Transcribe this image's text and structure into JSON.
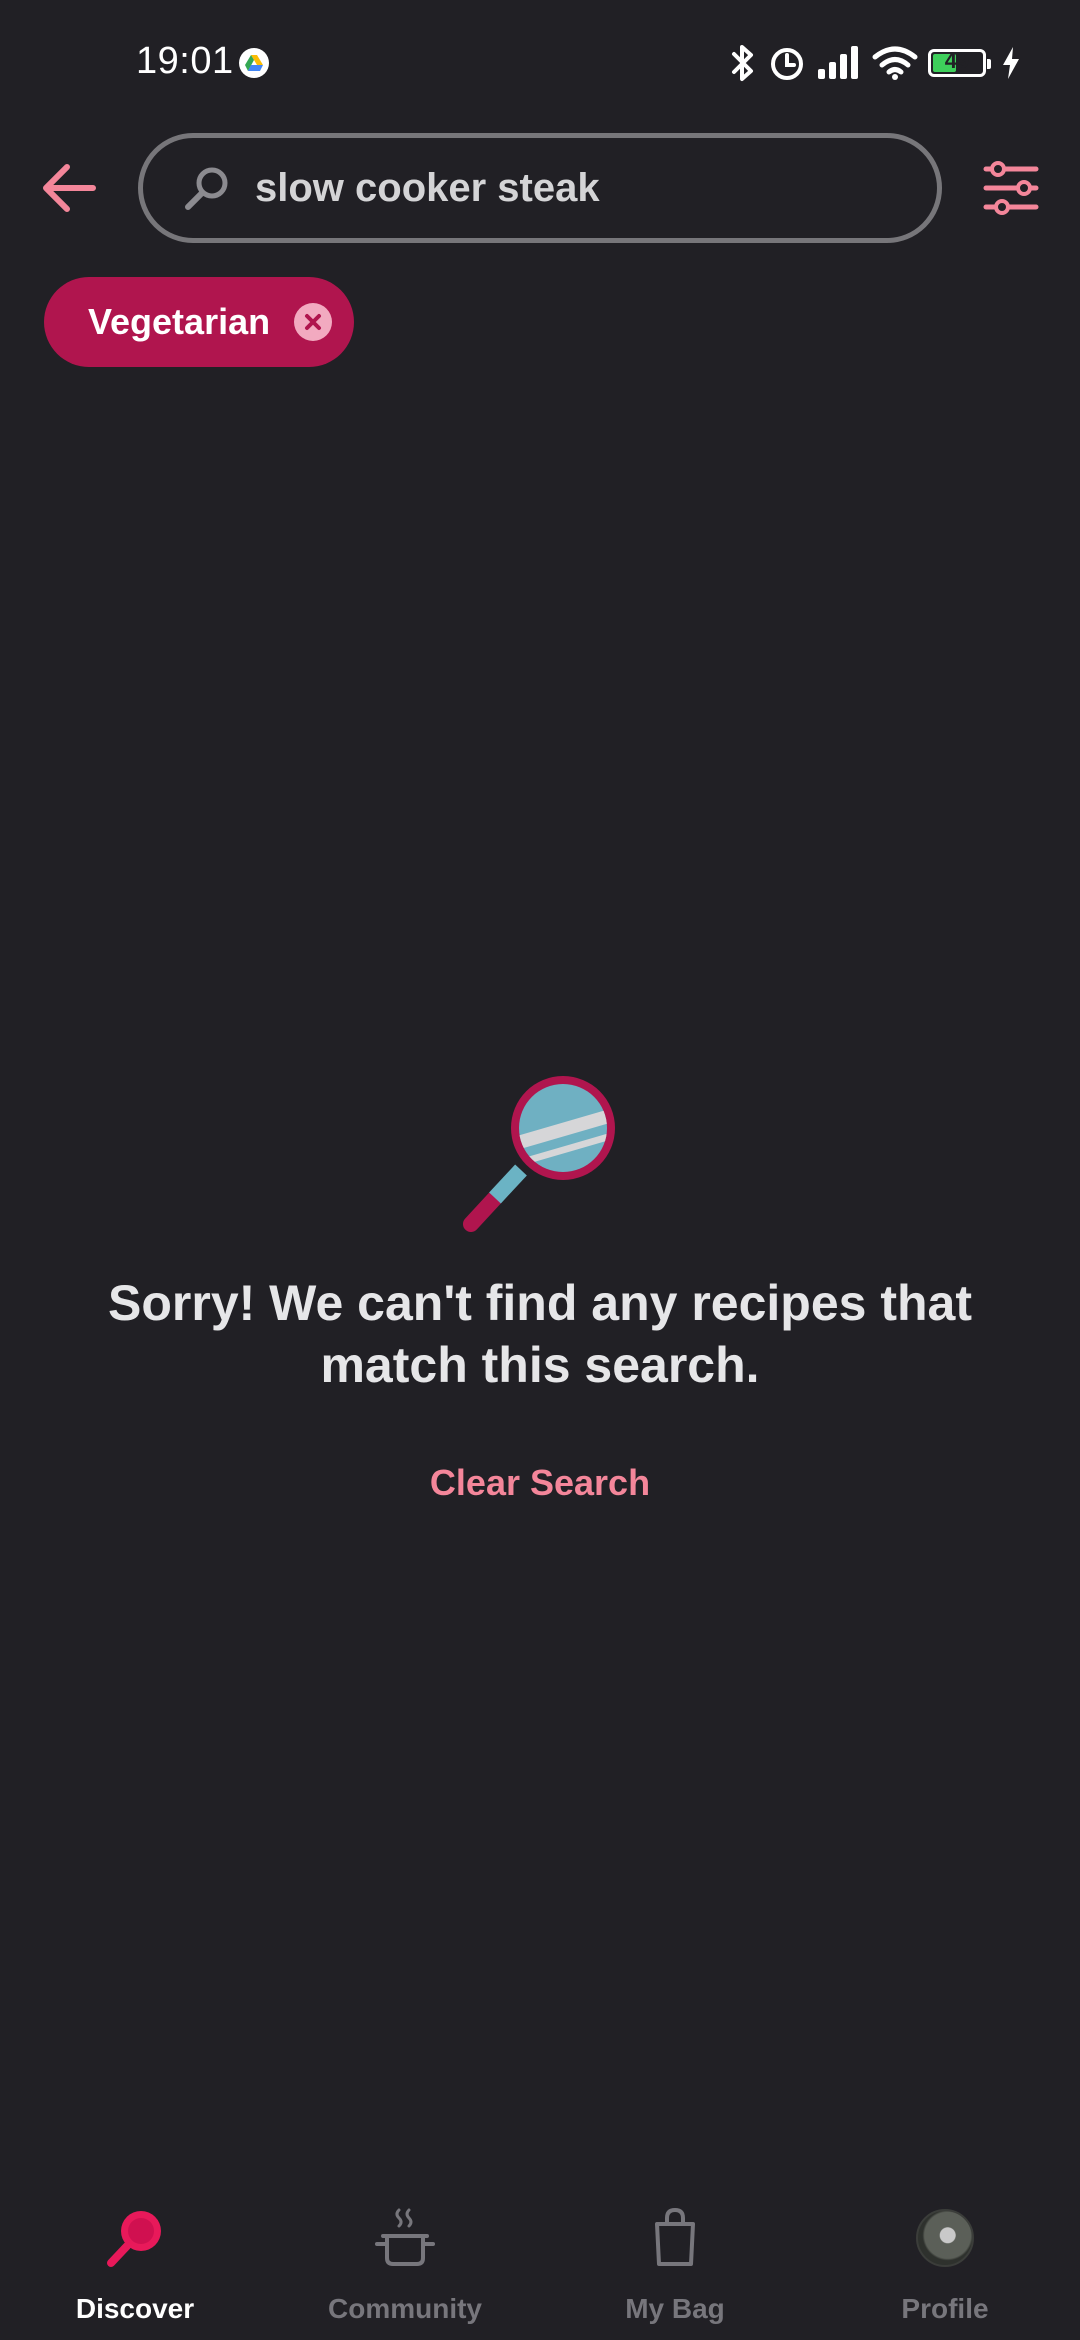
{
  "status_bar": {
    "time": "19:01",
    "battery_level": "49",
    "battery_fraction": 0.49,
    "icons": [
      "drive-icon",
      "bluetooth-icon",
      "alarm-icon",
      "signal-icon",
      "wifi-icon",
      "battery-icon",
      "charging-icon"
    ]
  },
  "header": {
    "back_icon": "arrow-left-icon",
    "search_value": "slow cooker steak",
    "search_icon": "search-icon",
    "filter_icon": "sliders-icon"
  },
  "filters": [
    {
      "label": "Vegetarian",
      "remove_icon": "close-icon"
    }
  ],
  "empty_state": {
    "illustration": "magnifying-glass-illustration",
    "message": "Sorry! We can't find any recipes that match this search.",
    "action_label": "Clear Search"
  },
  "bottom_nav": {
    "items": [
      {
        "label": "Discover",
        "icon": "search-pan-icon",
        "active": true
      },
      {
        "label": "Community",
        "icon": "cooking-pot-icon",
        "active": false
      },
      {
        "label": "My Bag",
        "icon": "shopping-bag-icon",
        "active": false
      },
      {
        "label": "Profile",
        "icon": "avatar",
        "active": false
      }
    ]
  },
  "colors": {
    "background": "#212025",
    "accent": "#b0154e",
    "accent_light": "#f4869a",
    "text": "#e6e6e8",
    "muted": "#77767c"
  }
}
